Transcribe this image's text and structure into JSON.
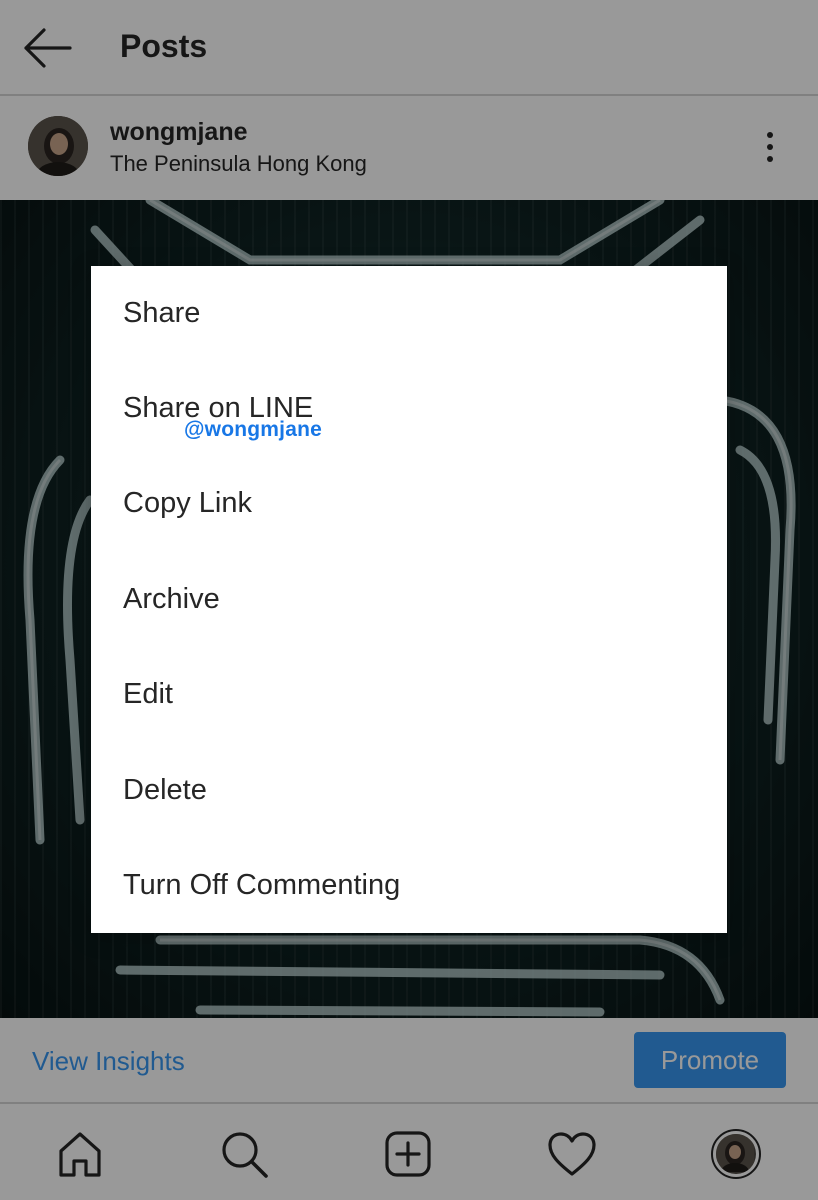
{
  "header": {
    "title": "Posts"
  },
  "post": {
    "username": "wongmjane",
    "location": "The Peninsula Hong Kong"
  },
  "actions": {
    "insights_label": "View Insights",
    "promote_label": "Promote"
  },
  "menu": {
    "items": [
      {
        "label": "Share"
      },
      {
        "label": "Share on LINE"
      },
      {
        "label": "Copy Link"
      },
      {
        "label": "Archive"
      },
      {
        "label": "Edit"
      },
      {
        "label": "Delete"
      },
      {
        "label": "Turn Off Commenting"
      }
    ]
  },
  "watermark": "@wongmjane",
  "bottom_nav": {
    "icons": [
      "home-icon",
      "search-icon",
      "add-post-icon",
      "heart-icon",
      "profile-avatar"
    ]
  },
  "colors": {
    "accent": "#3897f0",
    "text": "#262626",
    "overlay": "rgba(0,0,0,0.40)",
    "watermark": "#1877e6"
  }
}
